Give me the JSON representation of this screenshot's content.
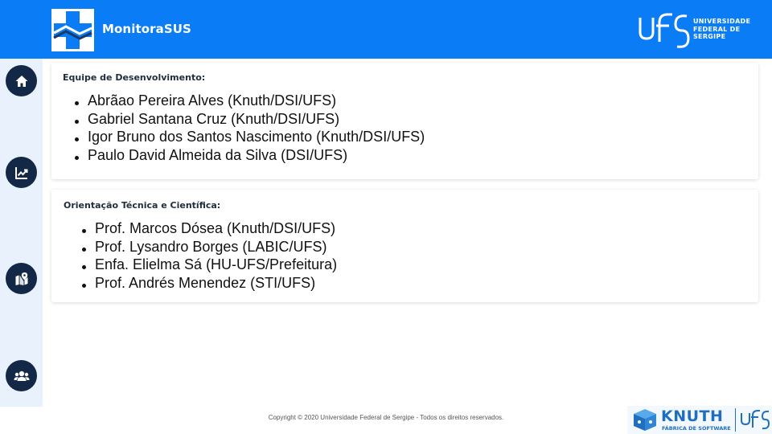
{
  "header": {
    "app_name": "MonitoraSUS",
    "university_logo_text": [
      "UNIVERSIDADE",
      "FEDERAL DE",
      "SERGIPE"
    ],
    "background_color": "#0a7cf5"
  },
  "sidebar": {
    "background_color": "#e9f2fc",
    "items": [
      {
        "icon": "home-icon"
      },
      {
        "icon": "chart-line-icon"
      },
      {
        "icon": "map-marker-icon"
      },
      {
        "icon": "users-icon"
      }
    ]
  },
  "dev_team": {
    "title": "Equipe de Desenvolvimento:",
    "members": [
      "Abrãao Pereira Alves (Knuth/DSI/UFS)",
      "Gabriel Santana Cruz (Knuth/DSI/UFS)",
      "Igor Bruno dos Santos Nascimento (Knuth/DSI/UFS)",
      "Paulo David Almeida da Silva (DSI/UFS)"
    ]
  },
  "guidance": {
    "title": "Orientação Técnica e Científica:",
    "members": [
      "Prof. Marcos Dósea (Knuth/DSI/UFS)",
      "Prof. Lysandro Borges (LABIC/UFS)",
      "Enfa. Elielma Sá (HU-UFS/Prefeitura)",
      "Prof. Andrés Menendez (STI/UFS)"
    ]
  },
  "footer": {
    "copyright": "Copyright © 2020 Universidade Federal de Sergipe - Todos os direitos reservados.",
    "knuth_logo_text": "KNUTH",
    "knuth_logo_subtext": "FÁBRICA DE SOFTWARE"
  }
}
